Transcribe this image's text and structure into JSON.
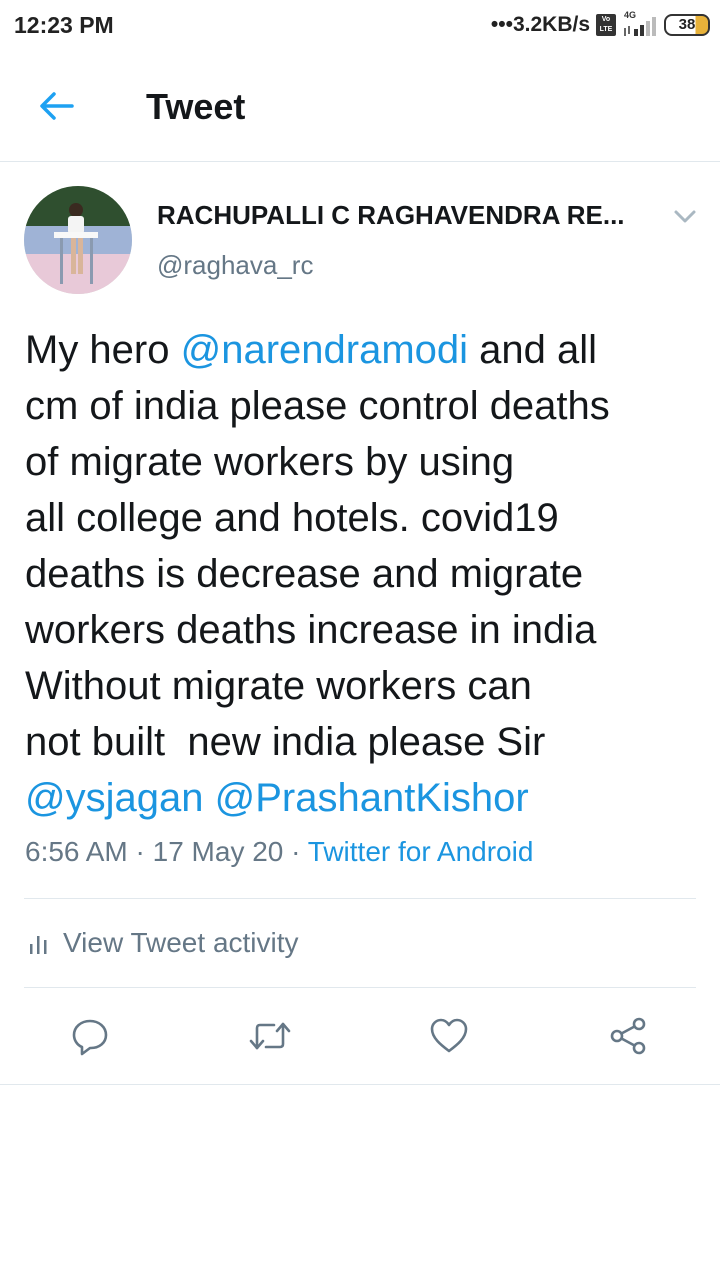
{
  "status_bar": {
    "time": "12:23 PM",
    "net_speed": "•••3.2KB/s",
    "volte_label": "Vo LTE",
    "network_type": "4G",
    "battery": "38"
  },
  "app_bar": {
    "title": "Tweet",
    "back_icon": "arrow-left-icon"
  },
  "tweet": {
    "author": {
      "name": "RACHUPALLI C RAGHAVENDRA RE...",
      "handle": "@raghava_rc"
    },
    "body_lines": [
      [
        {
          "t": "My hero "
        },
        {
          "t": "@narendramodi",
          "m": true
        },
        {
          "t": " and all"
        }
      ],
      [
        {
          "t": "cm of india please control deaths"
        }
      ],
      [
        {
          "t": "of migrate workers by using"
        }
      ],
      [
        {
          "t": "all college and hotels. covid19"
        }
      ],
      [
        {
          "t": "deaths is decrease and migrate"
        }
      ],
      [
        {
          "t": "workers deaths increase in india"
        }
      ],
      [
        {
          "t": "Without migrate workers can"
        }
      ],
      [
        {
          "t": "not built  new india please Sir"
        }
      ],
      [
        {
          "t": "@ysjagan",
          "m": true
        },
        {
          "t": " "
        },
        {
          "t": "@PrashantKishor",
          "m": true
        }
      ]
    ],
    "time": "6:56 AM",
    "date": "17 May 20",
    "source": "Twitter for Android",
    "separator": " · "
  },
  "activity": {
    "label": "View Tweet activity",
    "icon": "bar-chart-icon"
  },
  "actions": [
    {
      "name": "reply",
      "icon": "reply-icon"
    },
    {
      "name": "retweet",
      "icon": "retweet-icon"
    },
    {
      "name": "like",
      "icon": "heart-icon"
    },
    {
      "name": "share",
      "icon": "share-icon"
    }
  ],
  "colors": {
    "accent": "#1b95e0",
    "text": "#14171a",
    "secondary": "#657786",
    "divider": "#e1e8ed"
  }
}
